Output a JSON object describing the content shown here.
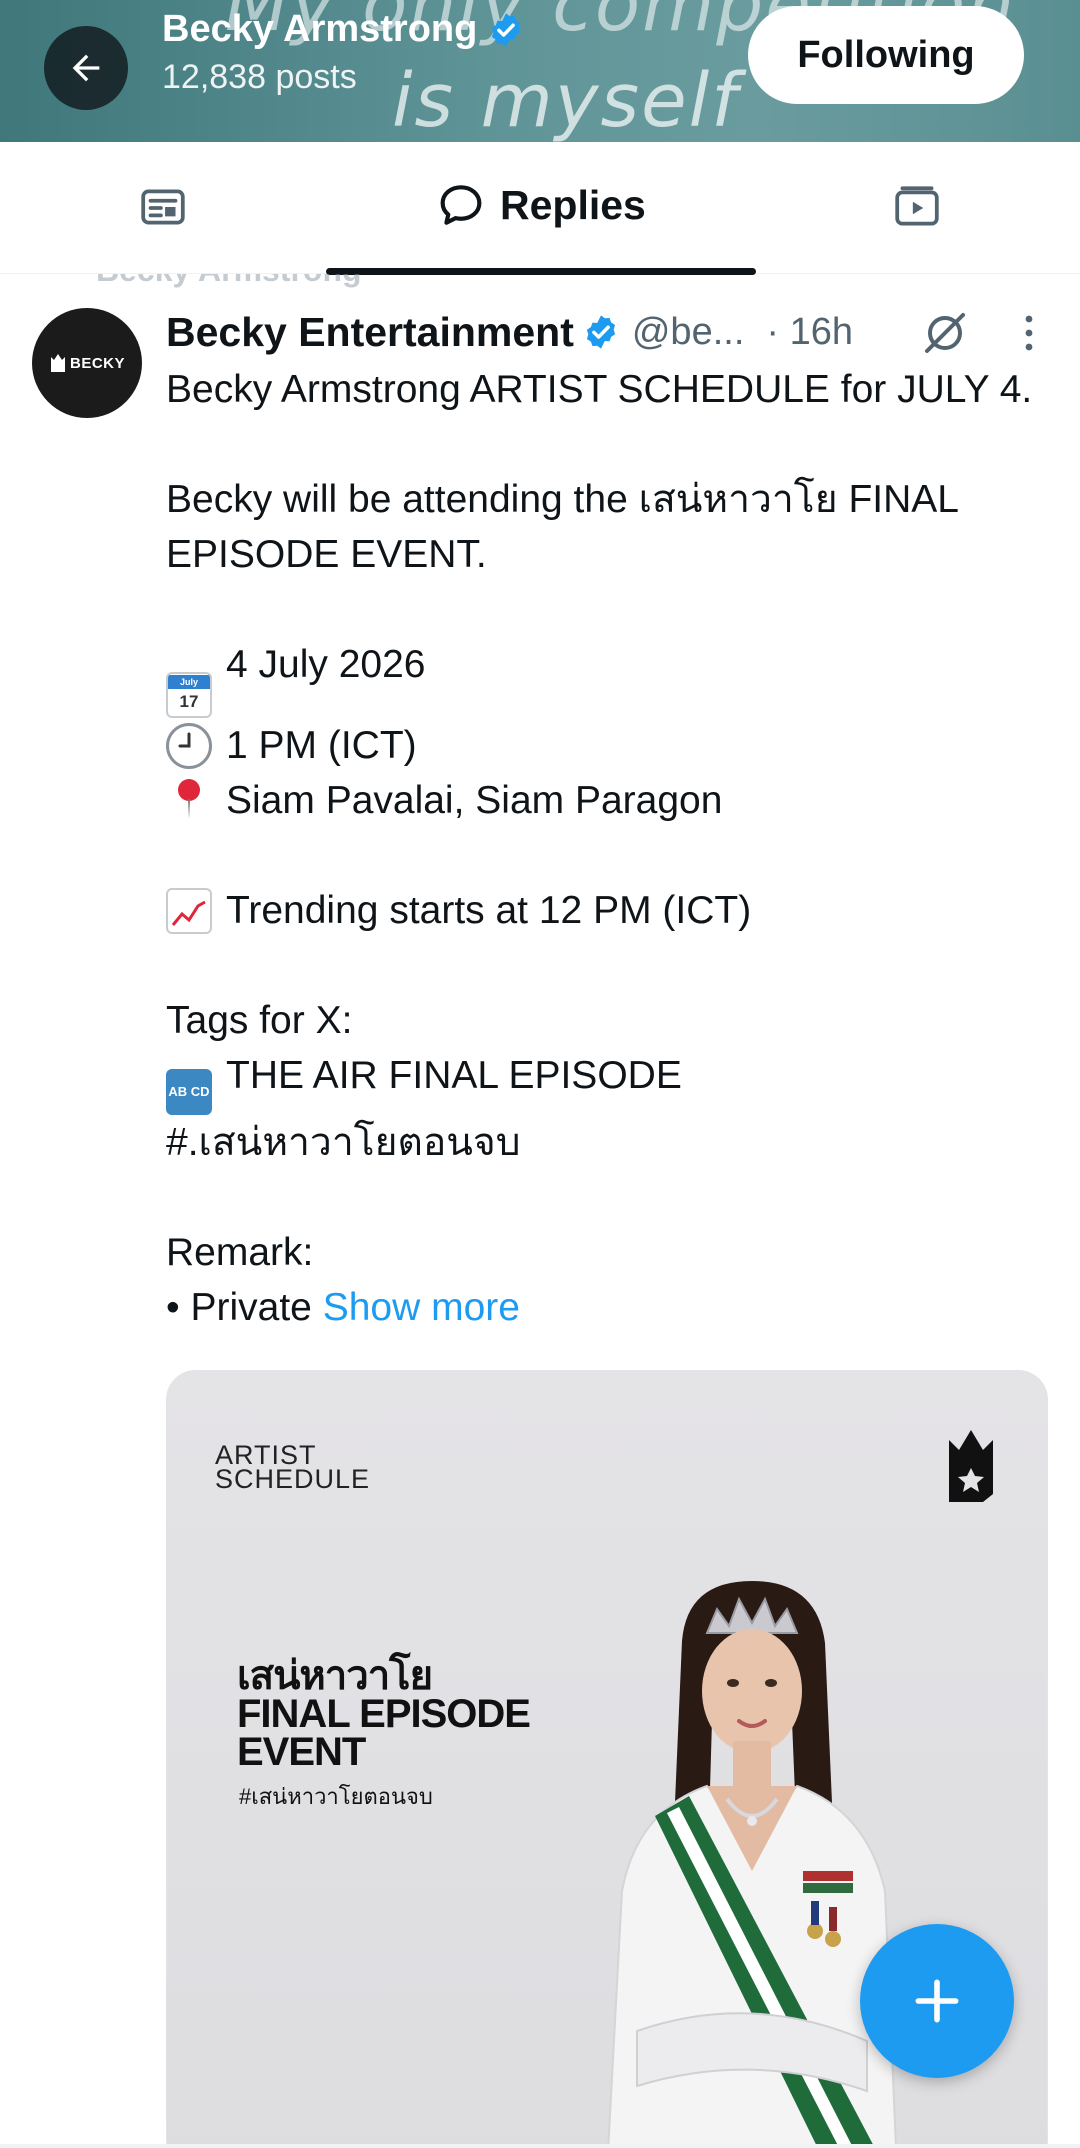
{
  "header": {
    "name": "Becky Armstrong",
    "posts": "12,838 posts",
    "banner_line1": "My only competition",
    "banner_line2": "is myself",
    "follow_label": "Following"
  },
  "tabs": {
    "active_label": "Replies"
  },
  "tweet": {
    "author": "Becky Entertainment",
    "handle": "@be...",
    "time": "· 16h",
    "avatar_text": "BECKY",
    "lines": [
      "Becky Armstrong ARTIST SCHEDULE for JULY 4.",
      "",
      "Becky will be attending the เสน่หาวาโย FINAL EPISODE EVENT.",
      "",
      "4 July 2026",
      "1 PM (ICT)",
      "Siam Pavalai, Siam Paragon",
      "",
      "Trending starts at 12 PM (ICT)",
      "",
      "Tags for X:",
      "THE AIR FINAL EPISODE",
      "#.เสน่หาวาโยตอนจบ",
      "",
      "Remark:",
      "• Private "
    ],
    "show_more": "Show more",
    "emoji": {
      "calendar_month": "July",
      "calendar_day": "17",
      "abcd": "AB CD"
    }
  },
  "media": {
    "artist_line1": "ARTIST",
    "artist_line2": "SCHEDULE",
    "title_line1": "เสน่หาวาโย",
    "title_line2": "FINAL EPISODE",
    "title_line3": "EVENT",
    "hashtag": "#เสน่หาวาโยตอนจบ"
  },
  "colors": {
    "accent": "#1d9bf0",
    "banner": "#5f9497",
    "text": "#0f1419",
    "secondary": "#536471"
  }
}
